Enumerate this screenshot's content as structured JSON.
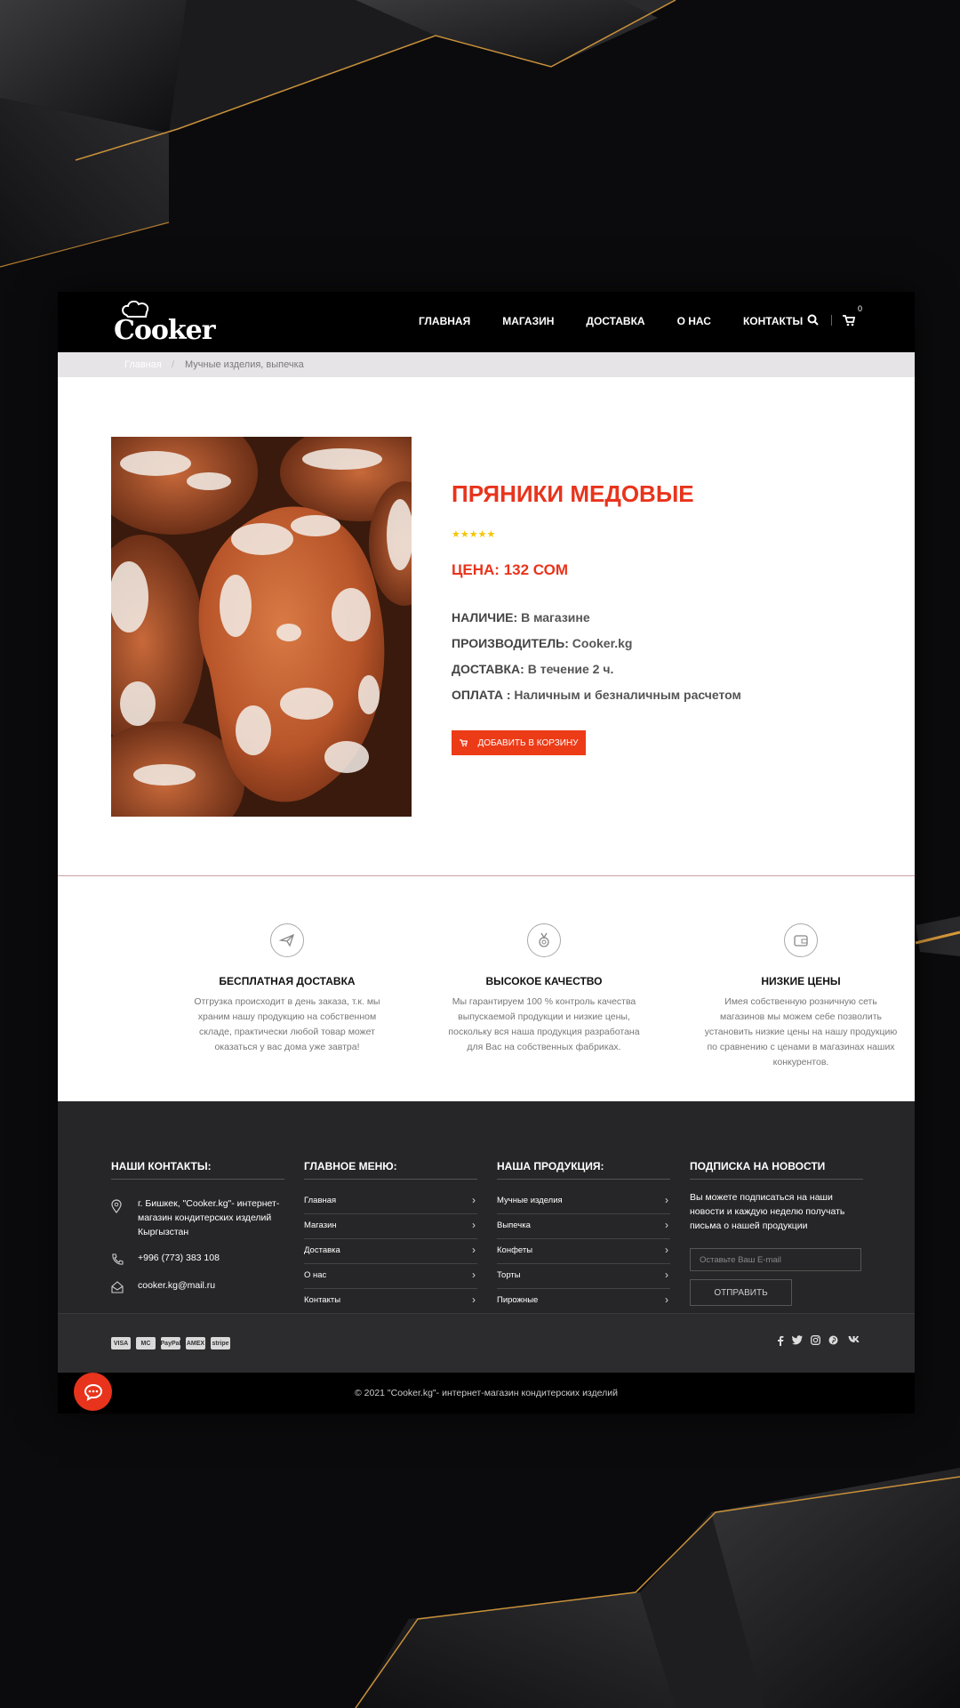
{
  "brand": {
    "logo_text": "Cooker"
  },
  "nav": {
    "items": [
      "ГЛАВНАЯ",
      "МАГАЗИН",
      "ДОСТАВКА",
      "О НАС",
      "КОНТАКТЫ"
    ],
    "cart_count": "0"
  },
  "breadcrumb": {
    "home": "Главная",
    "separator": "/",
    "current": "Мучные изделия, выпечка"
  },
  "product": {
    "title": "ПРЯНИКИ МЕДОВЫЕ",
    "rating": 5,
    "stars": "★★★★★",
    "price_label": "ЦЕНА:",
    "price_value": "132 СОМ",
    "specs": [
      {
        "key": "НАЛИЧИЕ:",
        "value": "В магазине"
      },
      {
        "key": "ПРОИЗВОДИТЕЛЬ:",
        "value": "Cooker.kg"
      },
      {
        "key": "ДОСТАВКА:",
        "value": "В течение 2 ч."
      },
      {
        "key": "ОПЛАТА :",
        "value": "Наличным и безналичным расчетом"
      }
    ],
    "add_to_cart": "ДОБАВИТЬ В КОРЗИНУ"
  },
  "features": [
    {
      "icon": "plane-icon",
      "title": "БЕСПЛАТНАЯ ДОСТАВКА",
      "text": "Отгрузка происходит в день заказа, т.к. мы храним нашу продукцию на собственном складе, практически любой товар может оказаться у вас дома уже завтра!"
    },
    {
      "icon": "medal-icon",
      "title": "ВЫСОКОЕ КАЧЕСТВО",
      "text": "Мы гарантируем 100 % контроль качества выпускаемой продукции и низкие цены, поскольку вся наша продукция разработана для Вас на собственных фабриках."
    },
    {
      "icon": "wallet-icon",
      "title": "НИЗКИЕ ЦЕНЫ",
      "text": "Имея собственную розничную сеть магазинов мы можем себе позволить установить низкие цены на нашу продукцию по сравнению с ценами в магазинах наших конкурентов."
    }
  ],
  "footer": {
    "contacts_title": "НАШИ КОНТАКТЫ:",
    "address": "г. Бишкек, \"Cooker.kg\"- интернет-магазин кондитерских изделий Кыргызстан",
    "phone": "+996 (773) 383 108",
    "email": "cooker.kg@mail.ru",
    "menu_title": "ГЛАВНОЕ МЕНЮ:",
    "menu_items": [
      "Главная",
      "Магазин",
      "Доставка",
      "О нас",
      "Контакты"
    ],
    "products_title": "НАША ПРОДУКЦИЯ:",
    "product_items": [
      "Мучные изделия",
      "Выпечка",
      "Конфеты",
      "Торты",
      "Пирожные"
    ],
    "subscribe_title": "ПОДПИСКА НА НОВОСТИ",
    "subscribe_text": "Вы можете подписаться на наши новости и каждую неделю получать письма о нашей продукции",
    "subscribe_placeholder": "Оставьте Ваш E-mail",
    "subscribe_button": "ОТПРАВИТЬ",
    "payments": [
      "VISA",
      "MC",
      "PayPal",
      "AMEX",
      "stripe"
    ],
    "social": [
      "f",
      "t",
      "ig",
      "p",
      "vk"
    ],
    "copyright": "© 2021 \"Cooker.kg\"- интернет-магазин кондитерских изделий"
  },
  "colors": {
    "accent": "#e8341c",
    "footer_bg": "#262527",
    "header_bg": "#000000"
  }
}
